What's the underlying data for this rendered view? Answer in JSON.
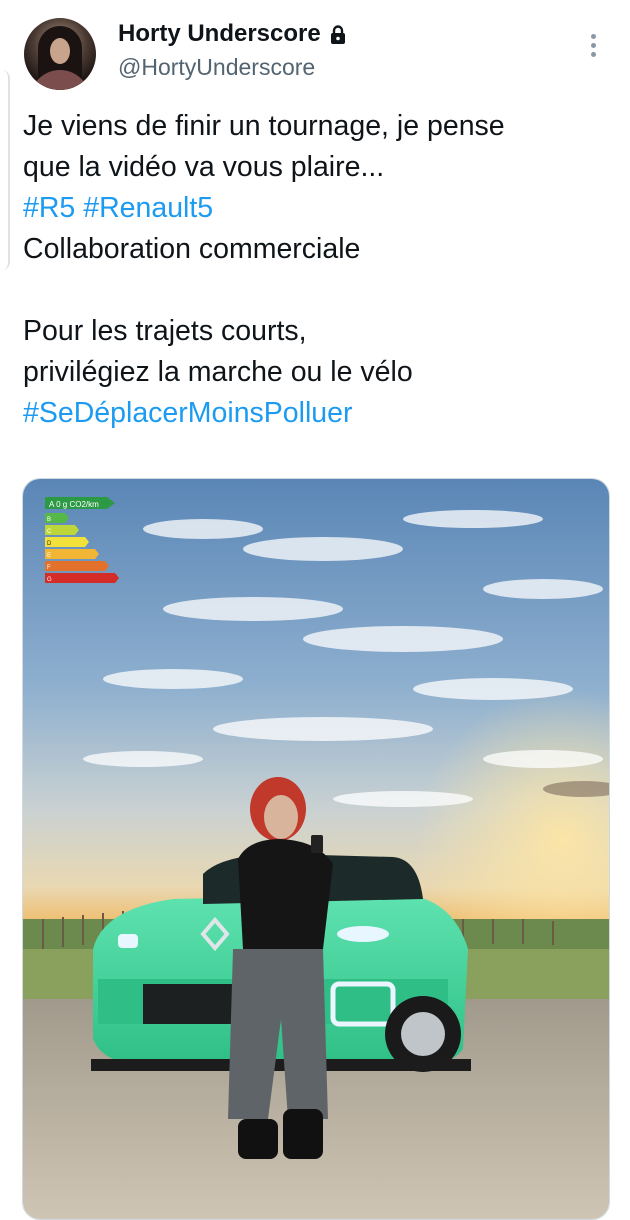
{
  "author": {
    "display_name": "Horty Underscore",
    "handle": "@HortyUnderscore",
    "avatar": "profile-photo",
    "lock_icon": "lock-icon",
    "more_icon": "more-options-icon"
  },
  "tweet": {
    "line1": "Je viens de finir un tournage, je pense",
    "line2": "que la vidéo va vous plaire...",
    "hashtag1": "#R5",
    "hashtag2": "#Renault5",
    "line4": "Collaboration commerciale",
    "line5": "Pour les trajets courts,",
    "line6": "privilégiez la marche ou le vélo",
    "hashtag3": "#SeDéplacerMoinsPolluer"
  },
  "media": {
    "energy_label_top": "A 0 g CO2/km",
    "energy_grades": [
      "B",
      "C",
      "D",
      "E",
      "F",
      "G"
    ],
    "colors": {
      "hashtag": "#1d9bf0",
      "car_body": "#3fd39a",
      "sky_top": "#5a86b6",
      "sunset": "#f2b04b"
    }
  }
}
